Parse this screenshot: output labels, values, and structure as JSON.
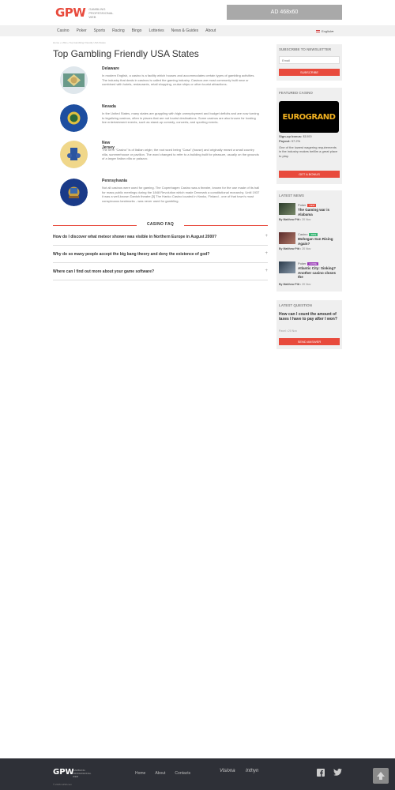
{
  "header": {
    "logo": "GPW",
    "logo_lines": [
      "GAMBLING",
      "PROFESSIONAL",
      "WEB"
    ],
    "ad_label": "AD 468x60"
  },
  "nav": {
    "items": [
      "Casino",
      "Poker",
      "Sports",
      "Racing",
      "Bingo",
      "Lotteries",
      "News & Guides",
      "About"
    ],
    "language": "English"
  },
  "breadcrumb": "Home » USA » Top Gambling Friendly USA States",
  "page_title": "Top Gambling Friendly USA States",
  "states": [
    {
      "name": "Delaware",
      "text": "In modern English, a casino is a facility which houses and accommodates certain types of gambling activities. The industry that deals in casinos is called the gaming industry. Casinos are most commonly built near or combined with hotels, restaurants, retail shopping, cruise ships or other tourist attractions."
    },
    {
      "name": "Nevada",
      "text": "In the United States, many states are grappling with high unemployment and budget deficits and are now turning to legalizing casinos, often in places that are not tourist destinations. Some casinos are also known for hosting live entertainment events, such as stand-up comedy, concerts, and sporting events."
    },
    {
      "name": "New Jersey",
      "text": "The term \"Casino\" is of Italian origin; the root word being \"Casa\" (house) and originally meant a small country villa, summerhouse or pavilion. The word changed to refer to a building built for pleasure, usually on the grounds of a larger Italian villa or palazzo."
    },
    {
      "name": "Pennsylvania",
      "text": "Not all casinos were used for gaming. The Copenhagen Casino was a theatre, known for the use made of its hall for mass public meetings during the 1848 Revolution which made Denmark a constitutional monarchy. Until 1937 it was a well-known Danish theatre.[3] The Hanko Casino located in Hanko, Finland - one of that town's most conspicuous landmarks - was never used for gambling."
    }
  ],
  "faq": {
    "heading": "CASINO FAQ",
    "questions": [
      "How do I discover what meteor shower was visible in Northern Europe in August 2000?",
      "Why do so many people accept the big bang theory and deny the existence of god?",
      "Where can I find out more about your game software?"
    ]
  },
  "sidebar": {
    "newsletter": {
      "title": "SUBSCRIBE TO NEWSLETTER",
      "placeholder": "Email",
      "button": "SUBSCRIBE"
    },
    "featured": {
      "title": "FEATURED CASINO",
      "logo": "EUROGRAND",
      "bonus_label": "Sign-up bonus:",
      "bonus_value": "$1000",
      "payout_label": "Payout:",
      "payout_value": "97.2%",
      "description": "One of the lowest wagering requirements in the industry makes bet8m a great place to play.",
      "button": "GET A BONUS"
    },
    "news": {
      "title": "LATEST NEWS",
      "items": [
        {
          "category": "Poker",
          "badge": "NEW",
          "badge_color": "#e84a3c",
          "title": "The Gaming war is Alabama",
          "author": "By Matthew Pitt",
          "date": "20 Nov"
        },
        {
          "category": "Casino",
          "badge": "TIPS",
          "badge_color": "#3cb878",
          "title": "Mohegan Sun Rising Again?",
          "author": "By Matthew Pitt",
          "date": "20 Nov"
        },
        {
          "category": "Poker",
          "badge": "GUIDE",
          "badge_color": "#9b3cb8",
          "title": "Atlantic City: Sinking? Another casino closes the",
          "author": "By Matthew Pitt",
          "date": "20 Nov"
        }
      ]
    },
    "question": {
      "title": "LATEST QUESTION",
      "text": "How can I count the amount of taxes I have to pay after I won?",
      "meta": "Pavel • 20 Nov",
      "button": "SEND ANSWER"
    }
  },
  "footer": {
    "logo": "GPW",
    "logo_lines": [
      "GAMBLING",
      "PROFESSIONAL",
      "WEB"
    ],
    "links": [
      "Home",
      "About",
      "Contacts"
    ],
    "partners": [
      "Visiona",
      "Inthyn"
    ],
    "copyright": "© 2015 GPW.com"
  },
  "colors": {
    "accent": "#e84a3c",
    "footer_bg": "#2e3037",
    "nav_bg": "#f1f1f1"
  }
}
